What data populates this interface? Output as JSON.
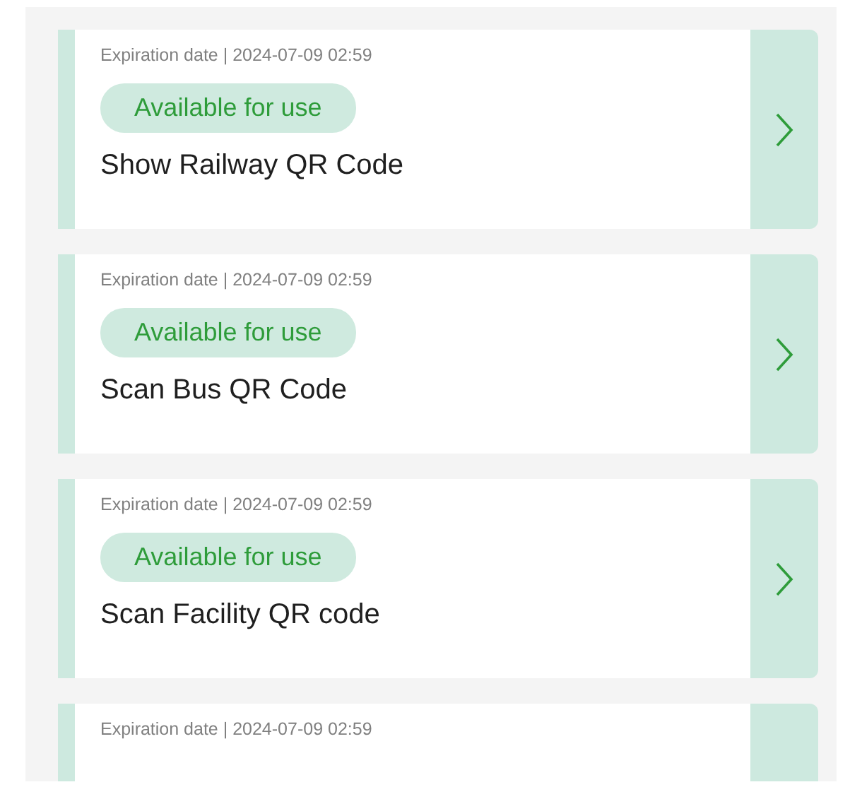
{
  "cards": [
    {
      "expiration": "Expiration date | 2024-07-09 02:59",
      "status": "Available for use",
      "title": "Show Railway QR Code"
    },
    {
      "expiration": "Expiration date | 2024-07-09 02:59",
      "status": "Available for use",
      "title": "Scan Bus QR Code"
    },
    {
      "expiration": "Expiration date | 2024-07-09 02:59",
      "status": "Available for use",
      "title": "Scan Facility QR code"
    },
    {
      "expiration": "Expiration date | 2024-07-09 02:59"
    }
  ]
}
